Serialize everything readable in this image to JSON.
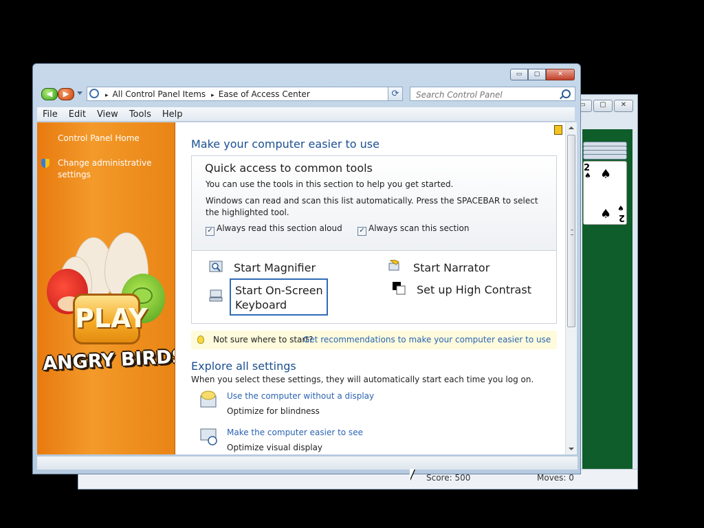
{
  "background_window": {
    "status": {
      "score": "Score: 500",
      "moves": "Moves:  0"
    },
    "cards": {
      "top_rank": "2",
      "bottom_rank": "2",
      "suit": "♠"
    },
    "caption_buttons": [
      "▭",
      "▢",
      "✕"
    ]
  },
  "window": {
    "caption_buttons": {
      "minimize": "▭",
      "maximize": "▢",
      "close": "✕"
    },
    "nav": {
      "back": "◀",
      "forward": "▶"
    },
    "address": {
      "crumbs": [
        "All Control Panel Items",
        "Ease of Access Center"
      ],
      "separator": "▸"
    },
    "refresh_glyph": "⟳",
    "search": {
      "placeholder": "Search Control Panel",
      "value": ""
    },
    "menu": [
      "File",
      "Edit",
      "View",
      "Tools",
      "Help"
    ]
  },
  "sidebar": {
    "home_link": "Control Panel Home",
    "admin_link": "Change administrative settings",
    "promo": {
      "button_text": "PLAY",
      "logo_text": "ANGRY BIRDS"
    }
  },
  "content": {
    "heading": "Make your computer easier to use",
    "quick": {
      "title": "Quick access to common tools",
      "line1": "You can use the tools in this section to help you get started.",
      "line2": "Windows can read and scan this list automatically.  Press the SPACEBAR to select",
      "line3": "the highlighted tool.",
      "check1": {
        "label": "Always read this section aloud",
        "checked": true
      },
      "check2": {
        "label": "Always scan this section",
        "checked": true
      },
      "check_mark": "✓",
      "tools": {
        "magnifier": "Start Magnifier",
        "narrator": "Start Narrator",
        "osk_line1": "Start On-Screen",
        "osk_line2": "Keyboard",
        "contrast": "Set up High Contrast"
      }
    },
    "hint": {
      "prefix": "Not sure where to start?",
      "link": "Get recommendations to make your computer easier to use"
    },
    "explore": {
      "heading": "Explore all settings",
      "description": "When you select these settings, they will automatically start each time you log on.",
      "items": [
        {
          "link": "Use the computer without a display",
          "sub": "Optimize for blindness"
        },
        {
          "link": "Make the computer easier to see",
          "sub": "Optimize visual display"
        }
      ]
    }
  },
  "colors": {
    "sidebar_orange": "#f39a2a",
    "link_blue": "#2a63b1",
    "heading_blue": "#1a4f91",
    "felt_green": "#0f5d2a"
  }
}
